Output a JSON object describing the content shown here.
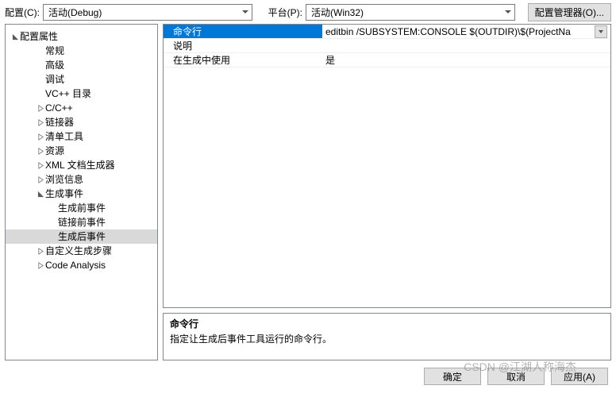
{
  "toolbar": {
    "config_label": "配置(C):",
    "config_value": "活动(Debug)",
    "platform_label": "平台(P):",
    "platform_value": "活动(Win32)",
    "config_manager_btn": "配置管理器(O)..."
  },
  "tree": {
    "root_label": "配置属性",
    "items": [
      {
        "label": "常规",
        "depth": 2,
        "expand": ""
      },
      {
        "label": "高级",
        "depth": 2,
        "expand": ""
      },
      {
        "label": "调试",
        "depth": 2,
        "expand": ""
      },
      {
        "label": "VC++ 目录",
        "depth": 2,
        "expand": ""
      },
      {
        "label": "C/C++",
        "depth": 2,
        "expand": "closed"
      },
      {
        "label": "链接器",
        "depth": 2,
        "expand": "closed"
      },
      {
        "label": "清单工具",
        "depth": 2,
        "expand": "closed"
      },
      {
        "label": "资源",
        "depth": 2,
        "expand": "closed"
      },
      {
        "label": "XML 文档生成器",
        "depth": 2,
        "expand": "closed"
      },
      {
        "label": "浏览信息",
        "depth": 2,
        "expand": "closed"
      },
      {
        "label": "生成事件",
        "depth": 2,
        "expand": "open"
      },
      {
        "label": "生成前事件",
        "depth": 3,
        "expand": ""
      },
      {
        "label": "链接前事件",
        "depth": 3,
        "expand": ""
      },
      {
        "label": "生成后事件",
        "depth": 3,
        "expand": "",
        "selected": true
      },
      {
        "label": "自定义生成步骤",
        "depth": 2,
        "expand": "closed"
      },
      {
        "label": "Code Analysis",
        "depth": 2,
        "expand": "closed"
      }
    ]
  },
  "grid": {
    "rows": [
      {
        "name": "命令行",
        "value": "editbin /SUBSYSTEM:CONSOLE $(OUTDIR)\\$(ProjectNa",
        "selected": true,
        "dropdown": true
      },
      {
        "name": "说明",
        "value": ""
      },
      {
        "name": "在生成中使用",
        "value": "是"
      }
    ]
  },
  "description": {
    "title": "命令行",
    "text": "指定让生成后事件工具运行的命令行。"
  },
  "footer": {
    "ok": "确定",
    "cancel": "取消",
    "apply": "应用(A)"
  },
  "watermark": "CSDN @江湖人称海杰"
}
